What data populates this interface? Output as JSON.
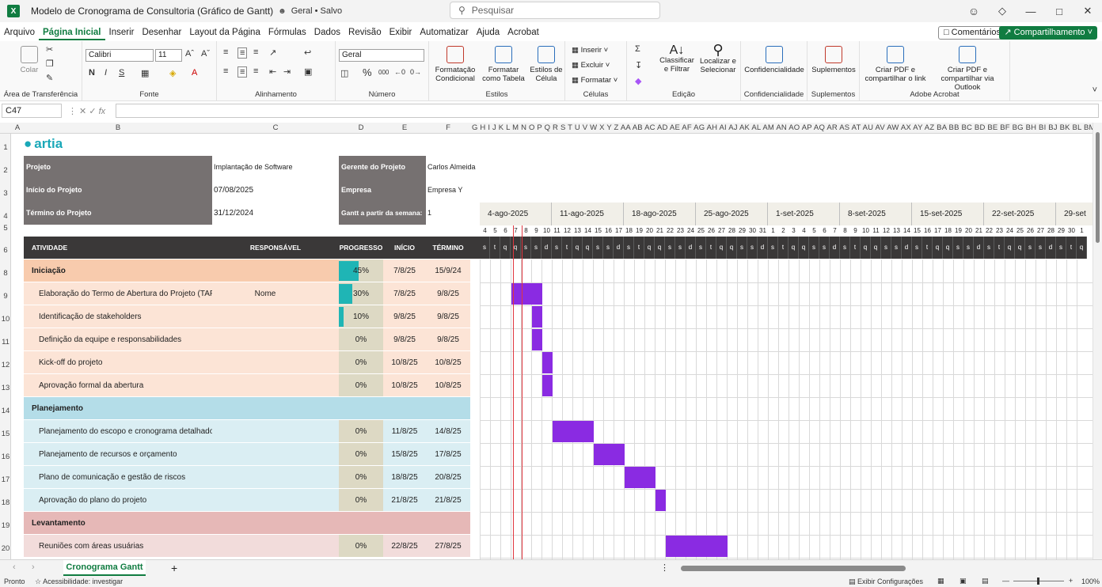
{
  "window": {
    "title": "Modelo de Cronograma de Consultoria (Gráfico de Gantt)",
    "save_state": "Geral • Salvo",
    "search_placeholder": "Pesquisar"
  },
  "menu": {
    "tabs": [
      "Arquivo",
      "Página Inicial",
      "Inserir",
      "Desenhar",
      "Layout da Página",
      "Fórmulas",
      "Dados",
      "Revisão",
      "Exibir",
      "Automatizar",
      "Ajuda",
      "Acrobat"
    ],
    "active": "Página Inicial",
    "comments": "Comentários",
    "share": "Compartilhamento"
  },
  "ribbon": {
    "clipboard": {
      "paste": "Colar",
      "label": "Área de Transferência"
    },
    "font": {
      "name": "Calibri",
      "size": "11",
      "label": "Fonte",
      "bold": "N",
      "italic": "I",
      "underline": "S"
    },
    "alignment": {
      "label": "Alinhamento"
    },
    "number": {
      "format": "Geral",
      "percent": "%",
      "thousands": "000",
      "label": "Número"
    },
    "styles": {
      "cond": "Formatação Condicional",
      "table": "Formatar como Tabela",
      "cell": "Estilos de Célula",
      "label": "Estilos"
    },
    "cells": {
      "insert": "Inserir",
      "delete": "Excluir",
      "format": "Formatar",
      "label": "Células"
    },
    "editing": {
      "sort": "Classificar e Filtrar",
      "find": "Localizar e Selecionar",
      "label": "Edição"
    },
    "confidentiality": {
      "btn": "Confidencialidade",
      "label": "Confidencialidade"
    },
    "addins": {
      "btn": "Suplementos",
      "label": "Suplementos"
    },
    "acrobat": {
      "pdf_link": "Criar PDF e compartilhar o link",
      "pdf_outlook": "Criar PDF e compartilhar via Outlook",
      "label": "Adobe Acrobat"
    }
  },
  "formula_bar": {
    "cell_ref": "C47",
    "fx": "fx",
    "content": ""
  },
  "columns_left": [
    "A",
    "B",
    "C",
    "D",
    "E",
    "F"
  ],
  "columns_right": "G H I J K L M N O P Q R S T U V W X Y Z AA AB AC AD AE AF AG AH AI AJ AK AL AM AN AO AP AQ AR AS AT AU AV AW AX AY AZ BA BB BC BD BE BF BG BH BI BJ BK BL BM BN BC",
  "row_numbers": [
    "1",
    "2",
    "3",
    "4",
    "5",
    "6",
    "8",
    "9",
    "10",
    "11",
    "12",
    "13",
    "14",
    "15",
    "16",
    "17",
    "18",
    "19",
    "20"
  ],
  "brand": "artia",
  "project": {
    "project_label": "Projeto",
    "project_value": "Implantação de Software",
    "start_label": "Início do Projeto",
    "start_value": "07/08/2025",
    "end_label": "Término do Projeto",
    "end_value": "31/12/2024",
    "manager_label": "Gerente do Projeto",
    "manager_value": "Carlos Almeida",
    "company_label": "Empresa",
    "company_value": "Empresa Y",
    "week_label": "Gantt a partir da semana:",
    "week_value": "1"
  },
  "table_headers": {
    "activity": "ATIVIDADE",
    "responsible": "RESPONSÁVEL",
    "progress": "PROGRESSO",
    "start": "INÍCIO",
    "end": "TÉRMINO"
  },
  "rows": [
    {
      "type": "phase",
      "name": "Iniciação",
      "responsible": "",
      "progress": "45%",
      "progress_value": 0.45,
      "start": "7/8/25",
      "end": "15/9/24",
      "color": "#f8cbad"
    },
    {
      "type": "task",
      "name": "Elaboração do Termo de Abertura do Projeto (TAP)",
      "responsible": "Nome",
      "progress": "30%",
      "progress_value": 0.3,
      "start": "7/8/25",
      "end": "9/8/25",
      "color": "#fce4d6",
      "bar_start": 3,
      "bar_days": 3
    },
    {
      "type": "task",
      "name": "Identificação de stakeholders",
      "responsible": "",
      "progress": "10%",
      "progress_value": 0.1,
      "start": "9/8/25",
      "end": "9/8/25",
      "color": "#fce4d6",
      "bar_start": 5,
      "bar_days": 1
    },
    {
      "type": "task",
      "name": "Definição da equipe e responsabilidades",
      "responsible": "",
      "progress": "0%",
      "progress_value": 0,
      "start": "9/8/25",
      "end": "9/8/25",
      "color": "#fce4d6",
      "bar_start": 5,
      "bar_days": 1
    },
    {
      "type": "task",
      "name": "Kick-off do projeto",
      "responsible": "",
      "progress": "0%",
      "progress_value": 0,
      "start": "10/8/25",
      "end": "10/8/25",
      "color": "#fce4d6",
      "bar_start": 6,
      "bar_days": 1
    },
    {
      "type": "task",
      "name": "Aprovação formal da abertura",
      "responsible": "",
      "progress": "0%",
      "progress_value": 0,
      "start": "10/8/25",
      "end": "10/8/25",
      "color": "#fce4d6",
      "bar_start": 6,
      "bar_days": 1
    },
    {
      "type": "phase",
      "name": "Planejamento",
      "responsible": "",
      "progress": "",
      "progress_value": 0,
      "start": "",
      "end": "",
      "color": "#b4dde8"
    },
    {
      "type": "task",
      "name": "Planejamento do escopo e cronograma detalhado",
      "responsible": "",
      "progress": "0%",
      "progress_value": 0,
      "start": "11/8/25",
      "end": "14/8/25",
      "color": "#daeef3",
      "bar_start": 7,
      "bar_days": 4
    },
    {
      "type": "task",
      "name": "Planejamento de recursos e orçamento",
      "responsible": "",
      "progress": "0%",
      "progress_value": 0,
      "start": "15/8/25",
      "end": "17/8/25",
      "color": "#daeef3",
      "bar_start": 11,
      "bar_days": 3
    },
    {
      "type": "task",
      "name": "Plano de comunicação e gestão de riscos",
      "responsible": "",
      "progress": "0%",
      "progress_value": 0,
      "start": "18/8/25",
      "end": "20/8/25",
      "color": "#daeef3",
      "bar_start": 14,
      "bar_days": 3
    },
    {
      "type": "task",
      "name": "Aprovação do plano do projeto",
      "responsible": "",
      "progress": "0%",
      "progress_value": 0,
      "start": "21/8/25",
      "end": "21/8/25",
      "color": "#daeef3",
      "bar_start": 17,
      "bar_days": 1
    },
    {
      "type": "phase",
      "name": "Levantamento",
      "responsible": "",
      "progress": "",
      "progress_value": 0,
      "start": "",
      "end": "",
      "color": "#e6b8b7"
    },
    {
      "type": "task",
      "name": "Reuniões com áreas usuárias",
      "responsible": "",
      "progress": "0%",
      "progress_value": 0,
      "start": "22/8/25",
      "end": "27/8/25",
      "color": "#f2dcdb",
      "bar_start": 18,
      "bar_days": 6
    }
  ],
  "gantt": {
    "weeks": [
      "4-ago-2025",
      "11-ago-2025",
      "18-ago-2025",
      "25-ago-2025",
      "1-set-2025",
      "8-set-2025",
      "15-set-2025",
      "22-set-2025",
      "29-set"
    ],
    "day_numbers": [
      "4",
      "5",
      "6",
      "7",
      "8",
      "9",
      "10",
      "11",
      "12",
      "13",
      "14",
      "15",
      "16",
      "17",
      "18",
      "19",
      "20",
      "21",
      "22",
      "23",
      "24",
      "25",
      "26",
      "27",
      "28",
      "29",
      "30",
      "31",
      "1",
      "2",
      "3",
      "4",
      "5",
      "6",
      "7",
      "8",
      "9",
      "10",
      "11",
      "12",
      "13",
      "14",
      "15",
      "16",
      "17",
      "18",
      "19",
      "20",
      "21",
      "22",
      "23",
      "24",
      "25",
      "26",
      "27",
      "28",
      "29",
      "30",
      "1"
    ],
    "day_letters": [
      "s",
      "t",
      "q",
      "q",
      "s",
      "s",
      "d"
    ],
    "bar_color": "#8a2be2",
    "today_color": "#e0373f"
  },
  "sheet_tab": "Cronograma Gantt",
  "status": {
    "ready": "Pronto",
    "accessibility": "Acessibilidade: investigar",
    "display_settings": "Exibir Configurações",
    "zoom": "100%"
  }
}
